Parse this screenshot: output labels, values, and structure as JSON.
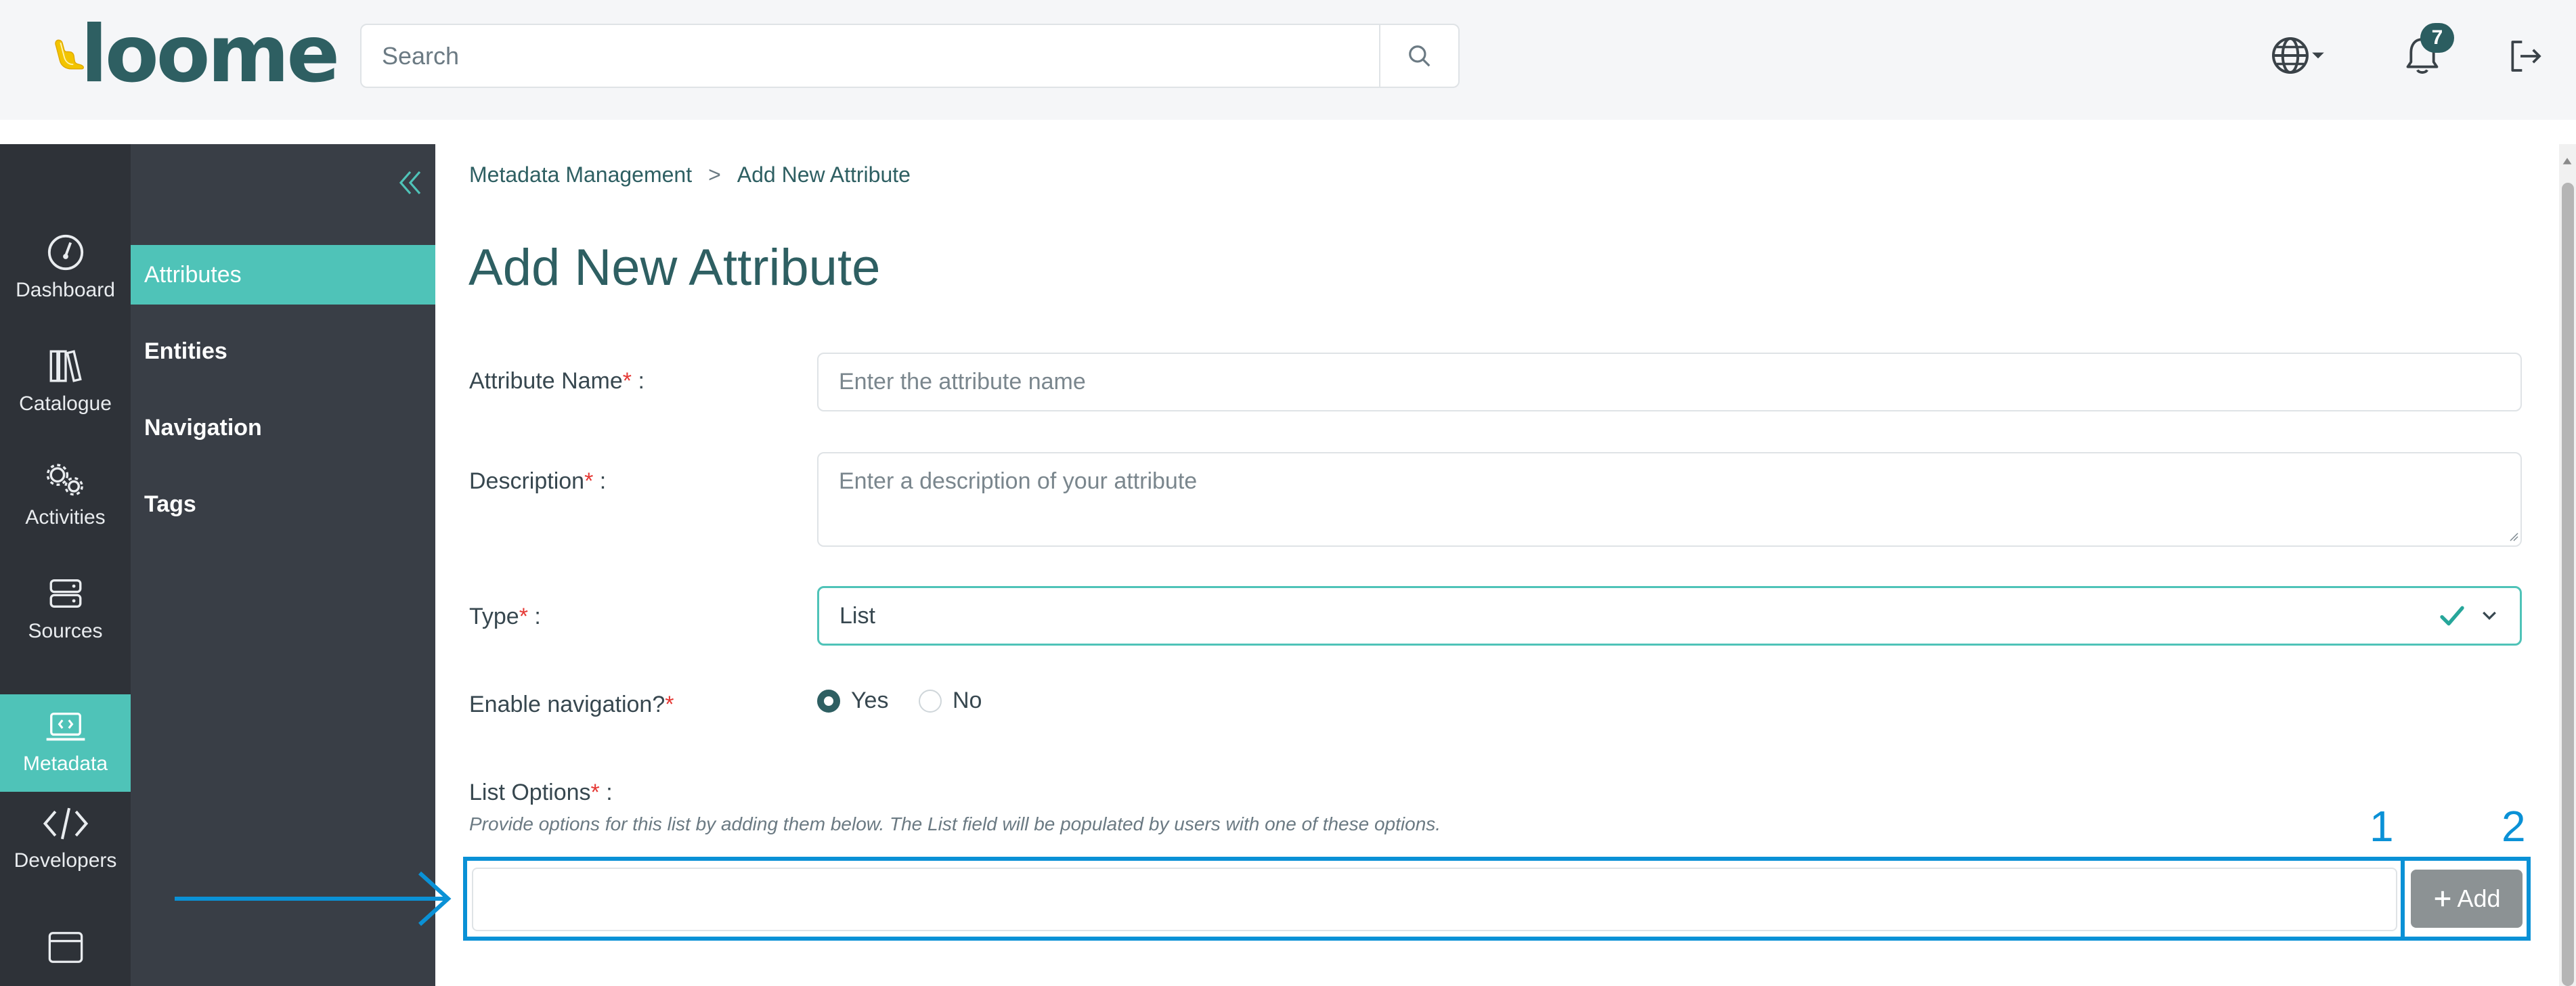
{
  "brand": {
    "name": "loome"
  },
  "header": {
    "search_placeholder": "Search",
    "notification_count": "7"
  },
  "rail": {
    "items": [
      {
        "label": "Dashboard",
        "icon": "gauge-icon"
      },
      {
        "label": "Catalogue",
        "icon": "books-icon"
      },
      {
        "label": "Activities",
        "icon": "gears-icon"
      },
      {
        "label": "Sources",
        "icon": "server-icon"
      },
      {
        "label": "Metadata",
        "icon": "laptop-code-icon",
        "active": true
      },
      {
        "label": "Developers",
        "icon": "code-icon"
      },
      {
        "label": "",
        "icon": "window-icon"
      }
    ]
  },
  "subnav": {
    "items": [
      {
        "label": "Attributes",
        "active": true
      },
      {
        "label": "Entities"
      },
      {
        "label": "Navigation"
      },
      {
        "label": "Tags"
      }
    ]
  },
  "breadcrumb": {
    "parent": "Metadata Management",
    "separator": ">",
    "current": "Add New Attribute"
  },
  "page": {
    "title": "Add New Attribute"
  },
  "form": {
    "name_label": "Attribute Name",
    "name_placeholder": "Enter the attribute name",
    "description_label": "Description",
    "description_placeholder": "Enter a description of your attribute",
    "type_label": "Type",
    "type_value": "List",
    "navigation_label": "Enable navigation?",
    "navigation_yes": "Yes",
    "navigation_no": "No",
    "navigation_selected": "Yes",
    "required_mark": "*",
    "label_suffix": " :",
    "list_options_label": "List Options",
    "list_options_help": "Provide options for this list by adding them below. The List field will be populated by users with one of these options.",
    "list_option_value": "",
    "add_label": "Add"
  },
  "annotations": {
    "marker_1": "1",
    "marker_2": "2"
  },
  "colors": {
    "accent": "#4fc3b8",
    "brand_dark": "#2e5f62",
    "annotation": "#0a91d6",
    "required": "#e53935",
    "rail_bg": "#2e3238",
    "subnav_bg": "#393e46"
  }
}
